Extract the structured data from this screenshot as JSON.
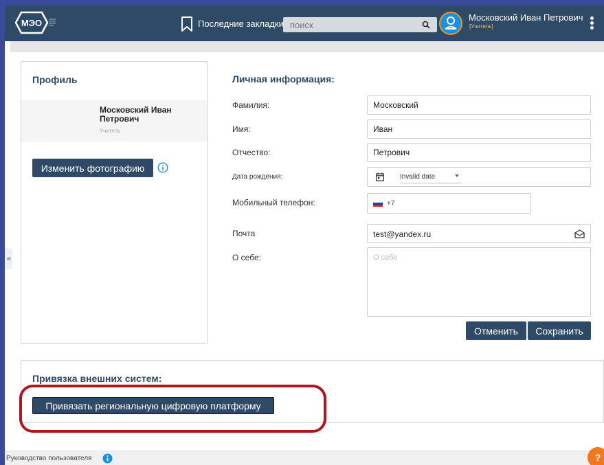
{
  "header": {
    "logo_text": "МЭО",
    "bookmarks_label": "Последние закладки",
    "search_placeholder": "поиск",
    "user_name": "Московский Иван Петрович",
    "user_role": "[Учитель]"
  },
  "profile": {
    "title": "Профиль",
    "name": "Московский Иван Петрович",
    "role": "Учитель",
    "change_photo_label": "Изменить фотографию"
  },
  "personal": {
    "title": "Личная информация:",
    "last_name_label": "Фамилия:",
    "last_name": "Московский",
    "first_name_label": "Имя:",
    "first_name": "Иван",
    "middle_name_label": "Отчество:",
    "middle_name": "Петрович",
    "birth_label": "Дата рождения:",
    "birth_value": "Invalid date",
    "phone_label": "Мобильный телефон:",
    "phone_code": "+7",
    "email_label": "Почта",
    "email": "test@yandex.ru",
    "about_label": "О себе:",
    "about_placeholder": "О себе",
    "cancel_label": "Отменить",
    "save_label": "Сохранить"
  },
  "external": {
    "title": "Привязка внешних систем:",
    "link_label": "Привязать региональную цифровую платформу"
  },
  "footer": {
    "guide_label": "Руководство пользователя",
    "help_label": "?"
  },
  "sidebar": {
    "collapse_glyph": "«"
  },
  "colors": {
    "header_bg": "#2e4a66",
    "accent": "#2e4a66",
    "highlight": "#b0141c",
    "avatar": "#1d8fe0",
    "help": "#f07820"
  }
}
